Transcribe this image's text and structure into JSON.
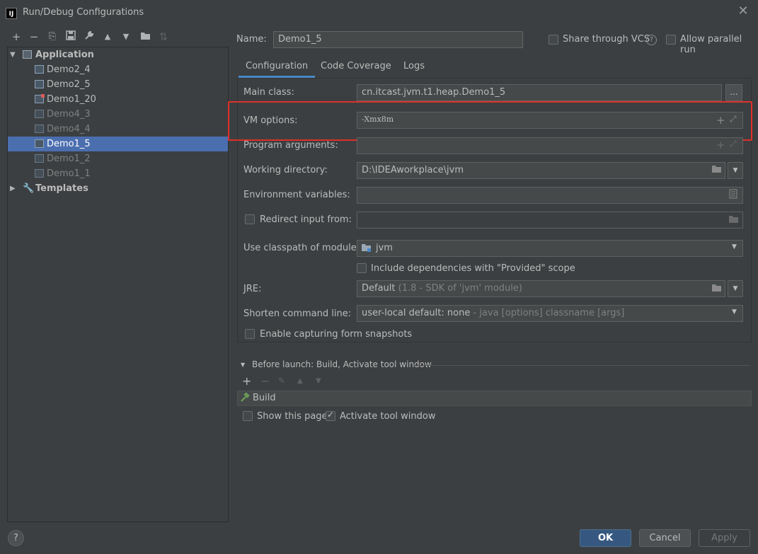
{
  "window": {
    "title": "Run/Debug Configurations",
    "app_icon_text": "IJ"
  },
  "toolbar": {
    "add": "+",
    "remove": "−",
    "copy": "⧉",
    "save": "💾",
    "edit_defaults": "🔧",
    "move_up": "▲",
    "move_down": "▼",
    "folder": "📁",
    "sort": "⇅"
  },
  "tree": {
    "application_label": "Application",
    "templates_label": "Templates",
    "items": [
      {
        "label": "Demo2_4"
      },
      {
        "label": "Demo2_5"
      },
      {
        "label": "Demo1_20"
      },
      {
        "label": "Demo4_3"
      },
      {
        "label": "Demo4_4"
      },
      {
        "label": "Demo1_5"
      },
      {
        "label": "Demo1_2"
      },
      {
        "label": "Demo1_1"
      }
    ]
  },
  "name_row": {
    "name_label": "Name:",
    "name_value": "Demo1_5",
    "share_label": "Share through VCS",
    "allow_parallel_label": "Allow parallel run"
  },
  "tabs": [
    "Configuration",
    "Code Coverage",
    "Logs"
  ],
  "config": {
    "main_class_label": "Main class:",
    "main_class_value": "cn.itcast.jvm.t1.heap.Demo1_5",
    "vm_options_label": "VM options:",
    "vm_options_value": "-Xmx8m",
    "program_args_label": "Program arguments:",
    "working_dir_label": "Working directory:",
    "working_dir_value": "D:\\IDEAworkplace\\jvm",
    "env_vars_label": "Environment variables:",
    "redirect_label": "Redirect input from:",
    "classpath_label": "Use classpath of module:",
    "classpath_value": "jvm",
    "include_deps_label": "Include dependencies with \"Provided\" scope",
    "jre_label": "JRE:",
    "jre_value": "Default",
    "jre_hint": "(1.8 - SDK of 'jvm' module)",
    "shorten_label": "Shorten command line:",
    "shorten_value": "user-local default: none",
    "shorten_hint": "- java [options] classname [args]",
    "capture_label": "Enable capturing form snapshots"
  },
  "before_launch": {
    "title": "Before launch: Build, Activate tool window",
    "build_label": "Build",
    "show_page_label": "Show this page",
    "activate_label": "Activate tool window"
  },
  "buttons": {
    "ok": "OK",
    "cancel": "Cancel",
    "apply": "Apply",
    "help": "?"
  }
}
